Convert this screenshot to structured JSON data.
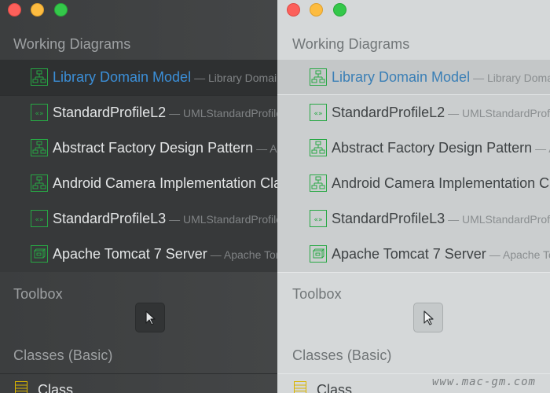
{
  "panels": [
    {
      "theme": "dark",
      "working_title": "Working Diagrams",
      "toolbox_title": "Toolbox",
      "classes_title": "Classes (Basic)",
      "class_item": "Class"
    },
    {
      "theme": "light",
      "working_title": "Working Diagrams",
      "toolbox_title": "Toolbox",
      "classes_title": "Classes (Basic)",
      "class_item": "Class"
    }
  ],
  "diagrams": [
    {
      "name": "Library Domain Model",
      "sub": "— Library Domain Model",
      "icon": "class-diagram-icon",
      "selected": true
    },
    {
      "name": "StandardProfileL2",
      "sub": "— UMLStandardProfiles",
      "icon": "profile-diagram-icon",
      "selected": false
    },
    {
      "name": "Abstract Factory Design Pattern",
      "sub": "— Abstract Factory",
      "icon": "class-diagram-icon",
      "selected": false
    },
    {
      "name": "Android Camera Implementation Class Diagram",
      "sub": "",
      "icon": "class-diagram-icon",
      "selected": false
    },
    {
      "name": "StandardProfileL3",
      "sub": "— UMLStandardProfiles",
      "icon": "profile-diagram-icon",
      "selected": false
    },
    {
      "name": "Apache Tomcat 7 Server",
      "sub": "— Apache Tomcat",
      "icon": "deployment-diagram-icon",
      "selected": false
    }
  ],
  "watermark": "www.mac-gm.com",
  "colors": {
    "selected_text_dark": "#3b8fd8",
    "selected_text_light": "#3a7fb6",
    "icon_green": "#27a844",
    "class_icon_yellow": "#d9b500"
  }
}
